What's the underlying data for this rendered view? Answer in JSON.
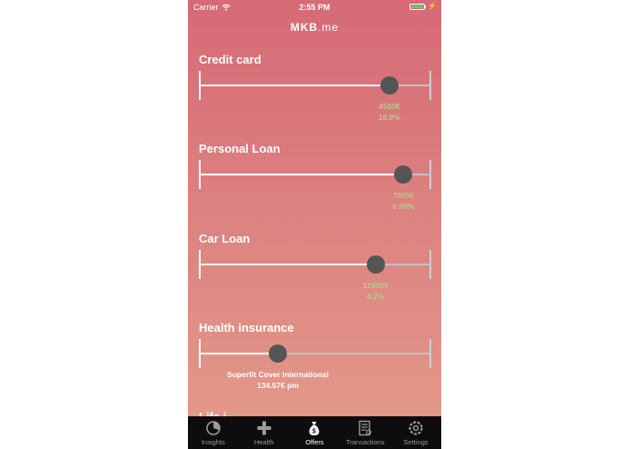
{
  "status_bar": {
    "carrier": "Carrier",
    "time": "2:55 PM"
  },
  "app": {
    "brand": "MKB",
    "tld": ".me"
  },
  "sliders": [
    {
      "label": "Credit card",
      "value": 0.82,
      "line1": "4500€",
      "line2": "18.9%",
      "value_color": "#b9c886"
    },
    {
      "label": "Personal Loan",
      "value": 0.88,
      "line1": "7000€",
      "line2": "6.99%",
      "value_color": "#b9c886"
    },
    {
      "label": "Car Loan",
      "value": 0.76,
      "line1": "12000€",
      "line2": "4.2%",
      "value_color": "#b9c886"
    },
    {
      "label": "Health insurance",
      "value": 0.34,
      "line1": "Superfit Cover International",
      "line2": "134.57€ pm",
      "value_color": "#ffffff"
    }
  ],
  "next_section_label": "Life i",
  "tabs": [
    {
      "label": "Insights",
      "icon": "insights-pie-icon",
      "active": false
    },
    {
      "label": "Health",
      "icon": "plus-icon",
      "active": false
    },
    {
      "label": "Offers",
      "icon": "money-bag-icon",
      "active": true
    },
    {
      "label": "Transactions",
      "icon": "receipt-icon",
      "active": false
    },
    {
      "label": "Settings",
      "icon": "gear-icon",
      "active": false
    }
  ],
  "colors": {
    "background_top": "#d66a76",
    "background_bottom": "#e39b8a",
    "value_green": "#b9c886",
    "thumb": "#555555",
    "battery": "#4cd964",
    "tab_bar": "#0d0d0d"
  }
}
